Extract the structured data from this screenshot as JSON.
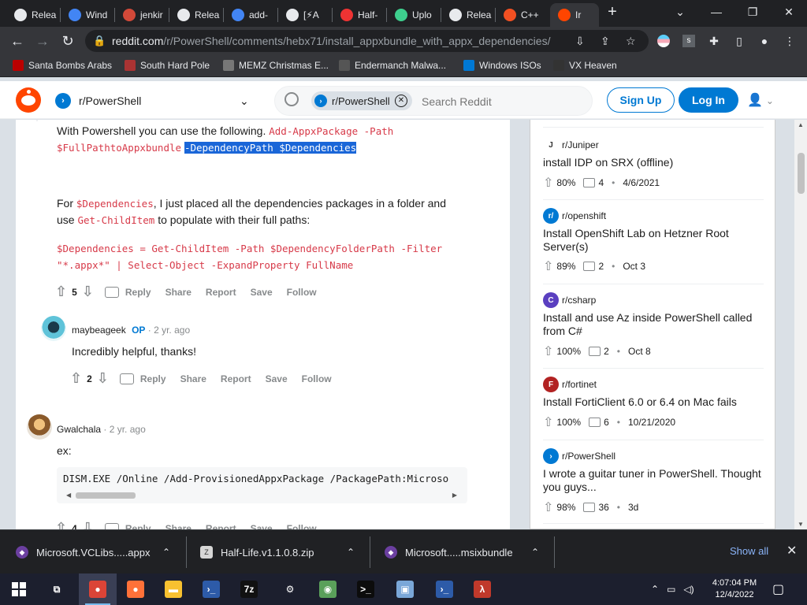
{
  "browser": {
    "tabs": [
      {
        "label": "Relea",
        "icon": "github-icon",
        "color": "#e8eaed"
      },
      {
        "label": "Wind",
        "icon": "google-icon",
        "color": "#4285f4"
      },
      {
        "label": "jenkir",
        "icon": "jenkins-icon",
        "color": "#d24939"
      },
      {
        "label": "Relea",
        "icon": "github-icon",
        "color": "#e8eaed"
      },
      {
        "label": "add-",
        "icon": "google-icon",
        "color": "#4285f4"
      },
      {
        "label": "[⚡A",
        "icon": "roblox-icon",
        "color": "#e8eaed"
      },
      {
        "label": "Half-",
        "icon": "halflife-icon",
        "color": "#e33"
      },
      {
        "label": "Uplo",
        "icon": "cloud-icon",
        "color": "#3ecf8e"
      },
      {
        "label": "Relea",
        "icon": "github-icon",
        "color": "#e8eaed"
      },
      {
        "label": "C++",
        "icon": "microsoft-icon",
        "color": "#f25022"
      },
      {
        "label": "Ir",
        "icon": "reddit-icon",
        "color": "#ff4500"
      }
    ],
    "new_tab": "+",
    "url_host": "reddit.com",
    "url_path": "/r/PowerShell/comments/hebx71/install_appxbundle_with_appx_dependencies/",
    "bookmarks": [
      {
        "label": "Santa Bombs Arabs",
        "icon": "bomb-icon"
      },
      {
        "label": "South Hard Pole",
        "icon": "virus-icon"
      },
      {
        "label": "MEMZ Christmas E...",
        "icon": "image-icon"
      },
      {
        "label": "Endermanch Malwa...",
        "icon": "cat-icon"
      },
      {
        "label": "Windows ISOs",
        "icon": "windows-icon"
      },
      {
        "label": "VX Heaven",
        "icon": "skull-icon"
      }
    ]
  },
  "reddit": {
    "community": "r/PowerShell",
    "search_chip": "r/PowerShell",
    "search_placeholder": "Search Reddit",
    "sign_up": "Sign Up",
    "log_in": "Log In"
  },
  "comment1": {
    "intro": "With Powershell you can use the following.",
    "code_a": "Add-AppxPackage -Path",
    "code_b": "$FullPathtoAppxbundle",
    "code_sel": "-DependencyPath $Dependencies",
    "p2_for": "For",
    "p2_var": "$Dependencies",
    "p2_rest": ", I just placed all the dependencies packages in a folder and",
    "p2_use": "use",
    "p2_cmd": "Get-ChildItem",
    "p2_tail": "to populate with their full paths:",
    "code_line1": "$Dependencies = Get-ChildItem -Path $DependencyFolderPath -Filter",
    "code_line2": "\"*.appx*\" | Select-Object -ExpandProperty FullName",
    "votes": "5"
  },
  "comment2": {
    "author": "maybeageek",
    "op": "OP",
    "age": "· 2 yr. ago",
    "body": "Incredibly helpful, thanks!",
    "votes": "2"
  },
  "comment3": {
    "author": "Gwalchala",
    "age": "· 2 yr. ago",
    "body": "ex:",
    "code": "DISM.EXE /Online /Add-ProvisionedAppxPackage /PackagePath:Microso",
    "votes": "4"
  },
  "actions": {
    "reply": "Reply",
    "share": "Share",
    "report": "Report",
    "save": "Save",
    "follow": "Follow"
  },
  "sidebar": {
    "posts": [
      {
        "sub": "r/Juniper",
        "title": "install IDP on SRX (offline)",
        "pct": "80%",
        "comments": "4",
        "date": "4/6/2021",
        "color": "#ffffff"
      },
      {
        "sub": "r/openshift",
        "title": "Install OpenShift Lab on Hetzner Root Server(s)",
        "pct": "89%",
        "comments": "2",
        "date": "Oct 3",
        "color": "#0079d3"
      },
      {
        "sub": "r/csharp",
        "title": "Install and use Az inside PowerShell called from C#",
        "pct": "100%",
        "comments": "2",
        "date": "Oct 8",
        "color": "#5a3fc0"
      },
      {
        "sub": "r/fortinet",
        "title": "Install FortiClient 6.0 or 6.4 on Mac fails",
        "pct": "100%",
        "comments": "6",
        "date": "10/21/2020",
        "color": "#b22222"
      },
      {
        "sub": "r/PowerShell",
        "title": "I wrote a guitar tuner in PowerShell. Thought you guys...",
        "pct": "98%",
        "comments": "36",
        "date": "3d",
        "color": "#0079d3"
      }
    ]
  },
  "downloads": {
    "items": [
      "Microsoft.VCLibs.....appx",
      "Half-Life.v1.1.0.8.zip",
      "Microsoft.....msixbundle"
    ],
    "show_all": "Show all"
  },
  "taskbar": {
    "time": "4:07:04 PM",
    "date": "12/4/2022",
    "apps": [
      {
        "name": "taskview",
        "glyph": "⧉",
        "color": "#1c1f2e"
      },
      {
        "name": "chrome",
        "glyph": "●",
        "color": "#db4437"
      },
      {
        "name": "firefox",
        "glyph": "●",
        "color": "#ff7139"
      },
      {
        "name": "explorer",
        "glyph": "▬",
        "color": "#f8c130"
      },
      {
        "name": "powershell",
        "glyph": "›_",
        "color": "#2d5ba8"
      },
      {
        "name": "7zip",
        "glyph": "7z",
        "color": "#111111"
      },
      {
        "name": "settings",
        "glyph": "⚙",
        "color": "#1c1f2e"
      },
      {
        "name": "maps",
        "glyph": "◉",
        "color": "#5aa05a"
      },
      {
        "name": "cmd",
        "glyph": ">_",
        "color": "#0c0c0c"
      },
      {
        "name": "rdp",
        "glyph": "▣",
        "color": "#7aa7d8"
      },
      {
        "name": "powershell2",
        "glyph": "›_",
        "color": "#2d5ba8"
      },
      {
        "name": "halflife",
        "glyph": "λ",
        "color": "#c0392b"
      }
    ]
  }
}
